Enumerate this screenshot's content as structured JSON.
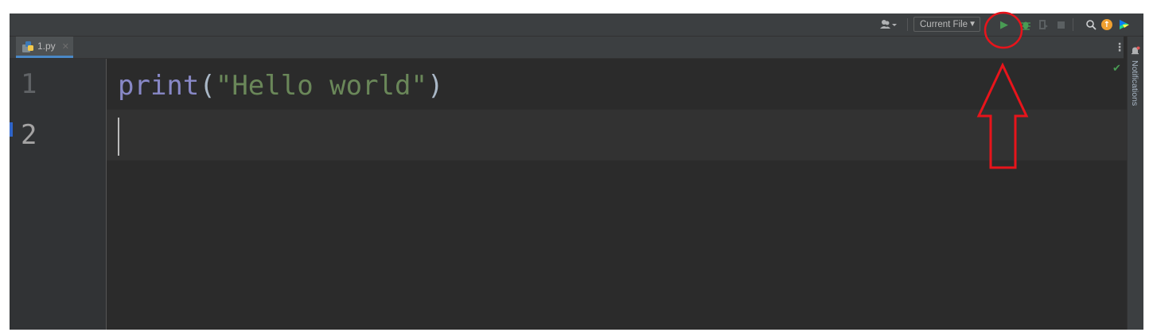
{
  "toolbar": {
    "run_config_label": "Current File",
    "icons": {
      "vcs_user": "user-icon",
      "run": "run-icon",
      "debug": "debug-icon",
      "coverage": "coverage-icon",
      "stop": "stop-icon",
      "search": "search-icon",
      "update": "update-icon",
      "jetbrains": "jetbrains-icon"
    }
  },
  "tabs": [
    {
      "label": "1.py",
      "active": true
    }
  ],
  "editor": {
    "line_numbers": [
      "1",
      "2"
    ],
    "code": {
      "func": "print",
      "open_paren": "(",
      "string": "\"Hello world\"",
      "close_paren": ")"
    }
  },
  "right_strip": {
    "notifications_label": "Notifications"
  },
  "colors": {
    "run_green": "#499c54",
    "annotation_red": "#e8141b",
    "tab_underline": "#4a88c7"
  }
}
